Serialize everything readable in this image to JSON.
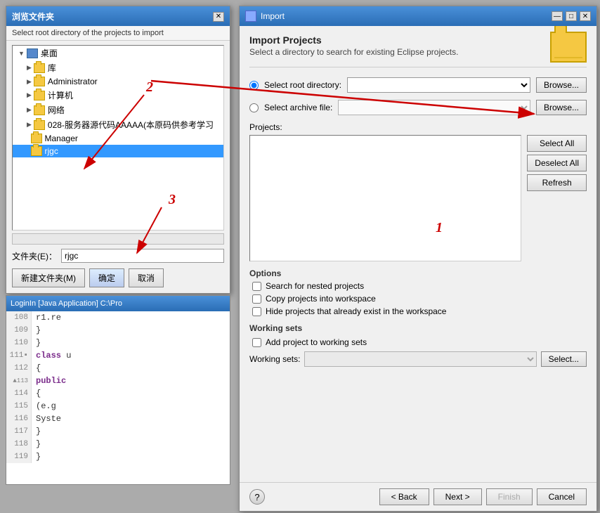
{
  "file_dialog": {
    "title": "浏览文件夹",
    "subtitle": "Select root directory of the projects to import",
    "close_btn": "✕",
    "tree_items": [
      {
        "label": "桌面",
        "type": "desktop",
        "indent": 0,
        "expanded": true
      },
      {
        "label": "库",
        "type": "folder",
        "indent": 1,
        "expanded": false
      },
      {
        "label": "Administrator",
        "type": "folder",
        "indent": 1,
        "expanded": false
      },
      {
        "label": "计算机",
        "type": "folder",
        "indent": 1,
        "expanded": false
      },
      {
        "label": "网络",
        "type": "folder",
        "indent": 1,
        "expanded": false
      },
      {
        "label": "028-服务器源代码AAAAA(本原码供参考学习",
        "type": "folder",
        "indent": 1,
        "expanded": false
      },
      {
        "label": "Manager",
        "type": "folder",
        "indent": 1,
        "expanded": false
      },
      {
        "label": "rjgc",
        "type": "folder",
        "indent": 1,
        "expanded": false,
        "selected": true
      }
    ],
    "filename_label": "文件夹(E)：",
    "filename_value": "rjgc",
    "btn_new": "新建文件夹(M)",
    "btn_ok": "确定",
    "btn_cancel": "取消"
  },
  "bottom_panel": {
    "title": "LoginIn [Java Application] C:\\Pro",
    "lines": [
      {
        "num": "108",
        "content": "  r1.re"
      },
      {
        "num": "109",
        "content": "  }"
      },
      {
        "num": "110",
        "content": "  }"
      },
      {
        "num": "111",
        "content": "  class u",
        "keyword": true
      },
      {
        "num": "112",
        "content": "  {"
      },
      {
        "num": "113",
        "content": "  public",
        "keyword": true,
        "marker": "▲"
      },
      {
        "num": "114",
        "content": "  {"
      },
      {
        "num": "115",
        "content": "    (e.g"
      },
      {
        "num": "116",
        "content": "    Syste"
      },
      {
        "num": "117",
        "content": "  }"
      },
      {
        "num": "118",
        "content": "  }"
      },
      {
        "num": "119",
        "content": "  }"
      }
    ]
  },
  "import_dialog": {
    "title": "Import",
    "heading": "Import Projects",
    "subtext": "Select a directory to search for existing Eclipse projects.",
    "close_btn": "✕",
    "min_btn": "—",
    "max_btn": "□",
    "radio_root_label": "Select root directory:",
    "radio_archive_label": "Select archive file:",
    "root_dropdown_value": "",
    "archive_dropdown_value": "",
    "browse_btn": "Browse...",
    "browse_btn2": "Browse...",
    "projects_label": "Projects:",
    "btn_select_all": "Select All",
    "btn_deselect_all": "Deselect All",
    "btn_refresh": "Refresh",
    "options_label": "Options",
    "check_nested": "Search for nested projects",
    "check_copy": "Copy projects into workspace",
    "check_hide": "Hide projects that already exist in the workspace",
    "working_sets_label": "Working sets",
    "check_add_ws": "Add project to working sets",
    "working_sets_text": "Working sets:",
    "ws_dropdown_value": "",
    "ws_select_btn": "Select...",
    "footer": {
      "help_label": "?",
      "back_btn": "< Back",
      "next_btn": "Next >",
      "finish_btn": "Finish",
      "cancel_btn": "Cancel"
    }
  },
  "annotations": {
    "num1": "1",
    "num2": "2",
    "num3": "3"
  }
}
